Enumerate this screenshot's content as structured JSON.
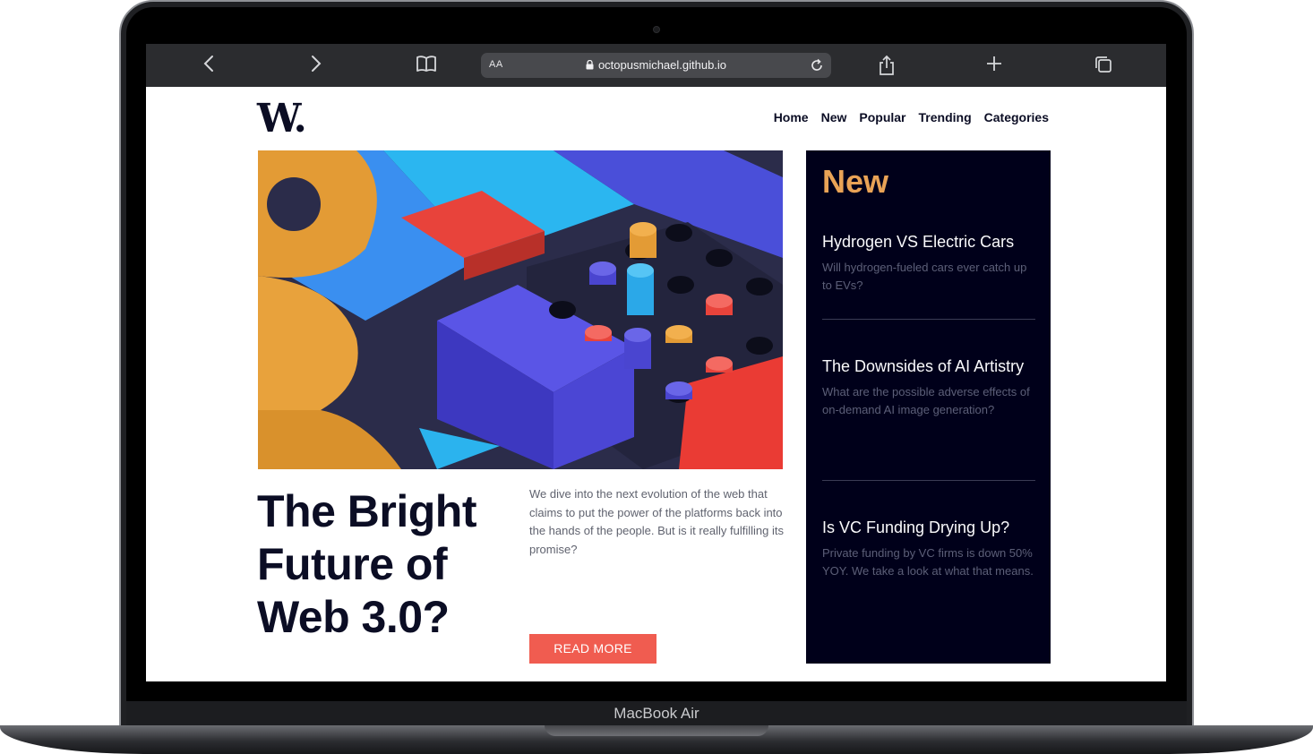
{
  "device": {
    "label": "MacBook Air"
  },
  "browser": {
    "aa_label": "AA",
    "url": "octopusmichael.github.io",
    "icons": [
      "back-icon",
      "forward-icon",
      "bookmarks-icon",
      "lock-icon",
      "reload-icon",
      "share-icon",
      "new-tab-icon",
      "tabs-icon"
    ]
  },
  "site": {
    "logo": "W.",
    "nav": [
      "Home",
      "New",
      "Popular",
      "Trending",
      "Categories"
    ]
  },
  "article": {
    "title": "The Bright Future of Web 3.0?",
    "excerpt": "We dive into the next evolution of the web that claims to put the power of the platforms back into the hands of the people. But is it really fulfilling its promise?",
    "cta": "READ MORE"
  },
  "sidebar": {
    "title": "New",
    "items": [
      {
        "title": "Hydrogen VS Electric Cars",
        "desc": "Will hydrogen-fueled cars ever catch up to EVs?"
      },
      {
        "title": "The Downsides of AI Artistry",
        "desc": "What are the possible adverse effects of on-demand AI image generation?"
      },
      {
        "title": "Is VC Funding Drying Up?",
        "desc": "Private funding by VC firms is down 50% YOY. We take a look at what that means."
      }
    ]
  },
  "colors": {
    "accent": "#e9a356",
    "button": "#f05c50",
    "dark": "#00001a",
    "text": "#0b0d24"
  }
}
